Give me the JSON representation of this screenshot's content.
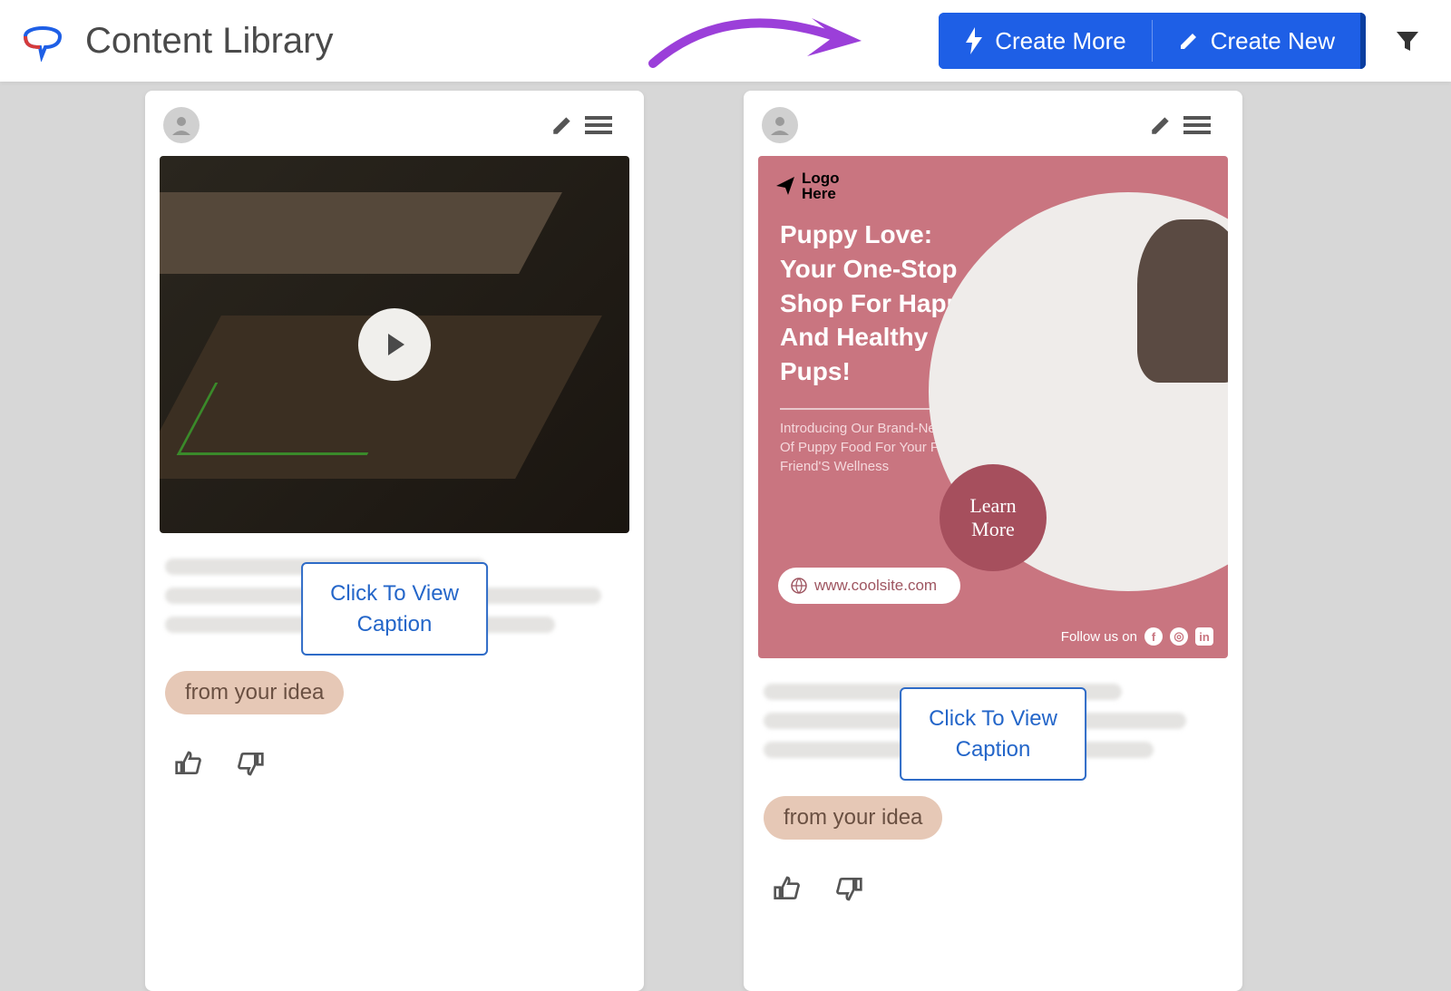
{
  "header": {
    "title": "Content Library",
    "create_more": "Create More",
    "create_new": "Create New"
  },
  "card1": {
    "caption_btn": "Click To View\nCaption",
    "tag": "from your idea"
  },
  "card2": {
    "flyer": {
      "logo_text": "Logo\nHere",
      "title": "Puppy Love: Your One-Stop Shop For Happy And Healthy Pups!",
      "subtitle": "Introducing Our Brand-New Line Of Puppy Food For Your Furry Friend'S Wellness",
      "learn": "Learn\nMore",
      "url": "www.coolsite.com",
      "follow": "Follow us on"
    },
    "caption_btn": "Click To View\nCaption",
    "tag": "from your idea"
  }
}
